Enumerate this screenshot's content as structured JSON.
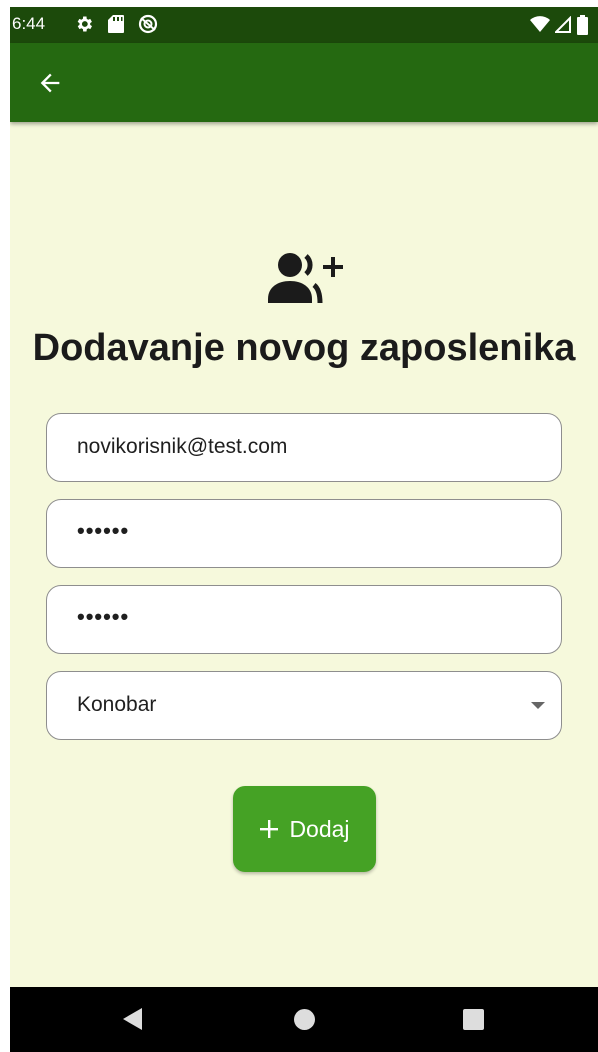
{
  "status_bar": {
    "time": "6:44",
    "left_icons": [
      "settings-icon",
      "sd-card-icon",
      "data-saver-icon"
    ],
    "right_icons": [
      "wifi-icon",
      "signal-icon",
      "battery-icon"
    ]
  },
  "app_bar": {
    "back_icon": "arrow-back-icon",
    "background_color": "#256911"
  },
  "form": {
    "header_icon": "person-add-icon",
    "title": "Dodavanje novog zaposlenika",
    "email_value": "novikorisnik@test.com",
    "password_value": "••••••",
    "confirm_password_value": "••••••",
    "role_selected": "Konobar",
    "submit_label": "Dodaj",
    "submit_icon": "add-icon",
    "submit_color": "#45a225",
    "background_color": "#f6f9dc"
  },
  "nav_bar": {
    "back_icon": "nav-back-icon",
    "home_icon": "nav-home-icon",
    "recents_icon": "nav-recents-icon"
  }
}
